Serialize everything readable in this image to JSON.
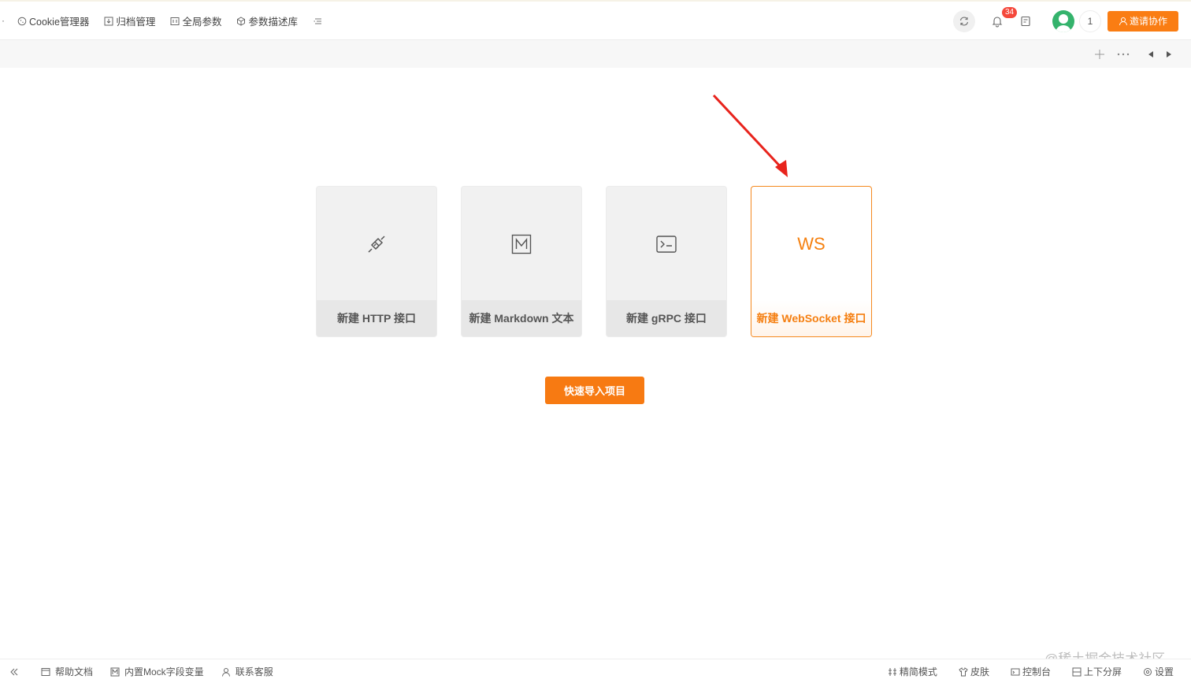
{
  "top_menu": {
    "items": [
      {
        "label": "Cookie管理器",
        "icon": "cookie-icon"
      },
      {
        "label": "归档管理",
        "icon": "archive-icon"
      },
      {
        "label": "全局参数",
        "icon": "params-icon"
      },
      {
        "label": "参数描述库",
        "icon": "cube-icon"
      }
    ]
  },
  "top_right": {
    "notification_count": "34",
    "member_count": "1",
    "invite_label": "邀请协作"
  },
  "cards": [
    {
      "label": "新建 HTTP 接口",
      "icon": "plug-icon"
    },
    {
      "label": "新建 Markdown 文本",
      "icon": "markdown-icon"
    },
    {
      "label": "新建 gRPC 接口",
      "icon": "terminal-icon"
    },
    {
      "label": "新建 WebSocket 接口",
      "icon_text": "WS"
    }
  ],
  "quick_import_label": "快速导入项目",
  "bottom_bar": {
    "left": [
      {
        "label": "帮助文档",
        "icon": "help-doc-icon"
      },
      {
        "label": "内置Mock字段变量",
        "icon": "mock-icon"
      },
      {
        "label": "联系客服",
        "icon": "user-icon"
      }
    ],
    "right": [
      {
        "label": "精简模式",
        "icon": "compact-icon"
      },
      {
        "label": "皮肤",
        "icon": "shirt-icon"
      },
      {
        "label": "控制台",
        "icon": "console-icon"
      },
      {
        "label": "上下分屏",
        "icon": "split-icon"
      },
      {
        "label": "设置",
        "icon": "gear-icon"
      }
    ]
  },
  "watermark": "@稀土掘金技术社区",
  "colors": {
    "accent": "#fa7d13",
    "badge": "#f5483b",
    "avatar": "#34b36c"
  }
}
